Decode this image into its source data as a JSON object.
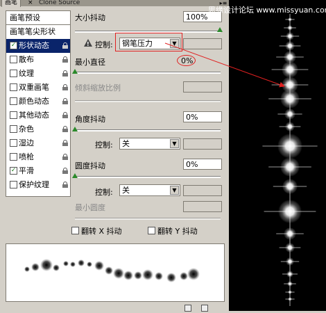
{
  "tabs": {
    "active": "画笔",
    "inactive": "Clone Source",
    "close": "×"
  },
  "watermark": {
    "text": "思缘设计论坛",
    "url": "www.missyuan.com"
  },
  "left_list": {
    "header": "画笔预设",
    "items": [
      {
        "label": "画笔笔尖形状",
        "checkbox": false,
        "checked": false,
        "lock": false,
        "selected": false
      },
      {
        "label": "形状动态",
        "checkbox": true,
        "checked": true,
        "lock": true,
        "selected": true
      },
      {
        "label": "散布",
        "checkbox": true,
        "checked": false,
        "lock": true,
        "selected": false
      },
      {
        "label": "纹理",
        "checkbox": true,
        "checked": false,
        "lock": true,
        "selected": false
      },
      {
        "label": "双重画笔",
        "checkbox": true,
        "checked": false,
        "lock": true,
        "selected": false
      },
      {
        "label": "颜色动态",
        "checkbox": true,
        "checked": false,
        "lock": true,
        "selected": false
      },
      {
        "label": "其他动态",
        "checkbox": true,
        "checked": false,
        "lock": true,
        "selected": false
      },
      {
        "label": "杂色",
        "checkbox": true,
        "checked": false,
        "lock": true,
        "selected": false
      },
      {
        "label": "湿边",
        "checkbox": true,
        "checked": false,
        "lock": true,
        "selected": false
      },
      {
        "label": "喷枪",
        "checkbox": true,
        "checked": false,
        "lock": true,
        "selected": false
      },
      {
        "label": "平滑",
        "checkbox": true,
        "checked": true,
        "lock": true,
        "selected": false
      },
      {
        "label": "保护纹理",
        "checkbox": true,
        "checked": false,
        "lock": true,
        "selected": false
      }
    ]
  },
  "size_jitter": {
    "label": "大小抖动",
    "value": "100%",
    "slider": 1.0
  },
  "size_control": {
    "label": "控制:",
    "selected": "钢笔压力"
  },
  "min_diameter": {
    "label": "最小直径",
    "value": "0%",
    "slider": 0.0
  },
  "tilt_scale": {
    "label": "倾斜缩放比例"
  },
  "angle_jitter": {
    "label": "角度抖动",
    "value": "0%",
    "slider": 0.0
  },
  "angle_control": {
    "label": "控制:",
    "selected": "关"
  },
  "roundness_jitter": {
    "label": "圆度抖动",
    "value": "0%",
    "slider": 0.0
  },
  "roundness_control": {
    "label": "控制:",
    "selected": "关"
  },
  "min_roundness": {
    "label": "最小圆度"
  },
  "flip_x": {
    "label": "翻转 X 抖动",
    "checked": false
  },
  "flip_y": {
    "label": "翻转 Y 抖动",
    "checked": false
  },
  "colors": {
    "selection": "#0a246a",
    "accent": "#2a8a2a",
    "annotation": "#e02020",
    "preview_bg": "#000000"
  }
}
